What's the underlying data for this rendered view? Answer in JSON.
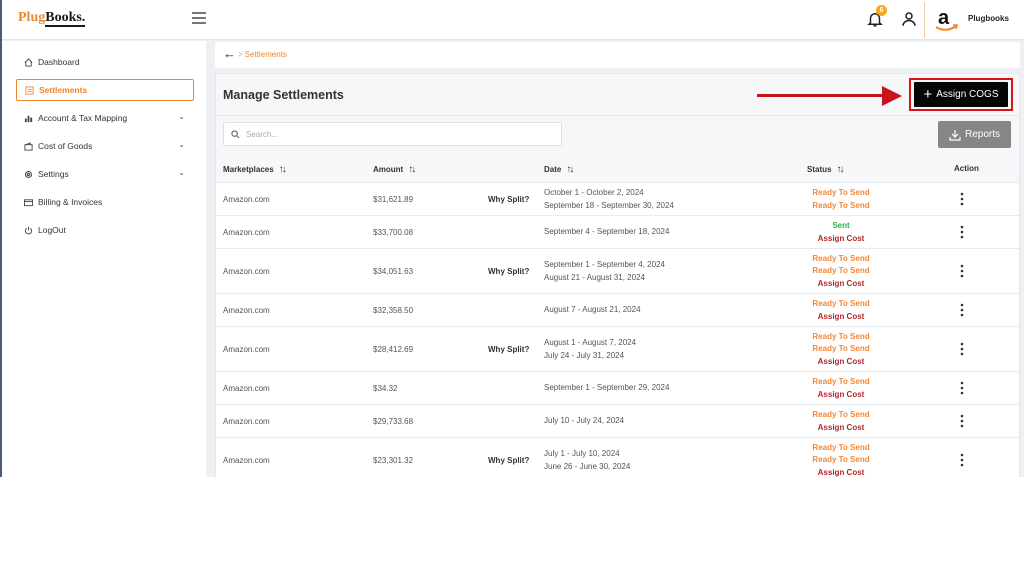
{
  "app": {
    "logo_part1": "Plug",
    "logo_part2": "Books.",
    "notification_count": "6",
    "account_name": "Plugbooks",
    "colors": {
      "brand_orange": "#f0862b",
      "assign_cogs_bg": "#050505",
      "reports_bg": "#868686",
      "highlight_red": "#d8141a",
      "status_ready": "#f58634",
      "status_sent": "#22b24c",
      "status_assign": "#b0272b"
    }
  },
  "sidebar": {
    "items": [
      {
        "label": "Dashboard",
        "icon": "home-icon",
        "active": false,
        "expandable": false
      },
      {
        "label": "Settlements",
        "icon": "document-icon",
        "active": true,
        "expandable": false
      },
      {
        "label": "Account & Tax Mapping",
        "icon": "bank-icon",
        "active": false,
        "expandable": true
      },
      {
        "label": "Cost of Goods",
        "icon": "wallet-icon",
        "active": false,
        "expandable": true
      },
      {
        "label": "Settings",
        "icon": "gear-icon",
        "active": false,
        "expandable": true
      },
      {
        "label": "Billing & Invoices",
        "icon": "credit-card-icon",
        "active": false,
        "expandable": false
      },
      {
        "label": "LogOut",
        "icon": "power-icon",
        "active": false,
        "expandable": false
      }
    ]
  },
  "breadcrumb": {
    "current": "Settlements"
  },
  "main": {
    "title": "Manage Settlements",
    "assign_cogs_label": "Assign COGS",
    "reports_label": "Reports",
    "search_placeholder": "Search..."
  },
  "table": {
    "columns": [
      "Marketplaces",
      "Amount",
      "Date",
      "Status",
      "Action"
    ],
    "why_split_label": "Why Split?",
    "rows": [
      {
        "marketplace": "Amazon.com",
        "amount": "$31,621.89",
        "why_split": true,
        "dates": [
          "October 1 - October 2, 2024",
          "September 18 - September 30, 2024"
        ],
        "statuses": [
          {
            "text": "Ready To Send",
            "kind": "ready"
          },
          {
            "text": "Ready To Send",
            "kind": "ready"
          }
        ]
      },
      {
        "marketplace": "Amazon.com",
        "amount": "$33,700.08",
        "why_split": false,
        "dates": [
          "September 4 - September 18, 2024"
        ],
        "statuses": [
          {
            "text": "Sent",
            "kind": "sent"
          },
          {
            "text": "Assign Cost",
            "kind": "assign"
          }
        ]
      },
      {
        "marketplace": "Amazon.com",
        "amount": "$34,051.63",
        "why_split": true,
        "dates": [
          "September 1 - September 4, 2024",
          "August 21 - August 31, 2024"
        ],
        "statuses": [
          {
            "text": "Ready To Send",
            "kind": "ready"
          },
          {
            "text": "Ready To Send",
            "kind": "ready"
          },
          {
            "text": "Assign Cost",
            "kind": "assign"
          }
        ]
      },
      {
        "marketplace": "Amazon.com",
        "amount": "$32,358.50",
        "why_split": false,
        "dates": [
          "August 7 - August 21, 2024"
        ],
        "statuses": [
          {
            "text": "Ready To Send",
            "kind": "ready"
          },
          {
            "text": "Assign Cost",
            "kind": "assign"
          }
        ]
      },
      {
        "marketplace": "Amazon.com",
        "amount": "$28,412.69",
        "why_split": true,
        "dates": [
          "August 1 - August 7, 2024",
          "July 24 - July 31, 2024"
        ],
        "statuses": [
          {
            "text": "Ready To Send",
            "kind": "ready"
          },
          {
            "text": "Ready To Send",
            "kind": "ready"
          },
          {
            "text": "Assign Cost",
            "kind": "assign"
          }
        ]
      },
      {
        "marketplace": "Amazon.com",
        "amount": "$34.32",
        "why_split": false,
        "dates": [
          "September 1 - September 29, 2024"
        ],
        "statuses": [
          {
            "text": "Ready To Send",
            "kind": "ready"
          },
          {
            "text": "Assign Cost",
            "kind": "assign"
          }
        ]
      },
      {
        "marketplace": "Amazon.com",
        "amount": "$29,733.68",
        "why_split": false,
        "dates": [
          "July 10 - July 24, 2024"
        ],
        "statuses": [
          {
            "text": "Ready To Send",
            "kind": "ready"
          },
          {
            "text": "Assign Cost",
            "kind": "assign"
          }
        ]
      },
      {
        "marketplace": "Amazon.com",
        "amount": "$23,301.32",
        "why_split": true,
        "dates": [
          "July 1 - July 10, 2024",
          "June 26 - June 30, 2024"
        ],
        "statuses": [
          {
            "text": "Ready To Send",
            "kind": "ready"
          },
          {
            "text": "Ready To Send",
            "kind": "ready"
          },
          {
            "text": "Assign Cost",
            "kind": "assign"
          }
        ]
      }
    ]
  }
}
